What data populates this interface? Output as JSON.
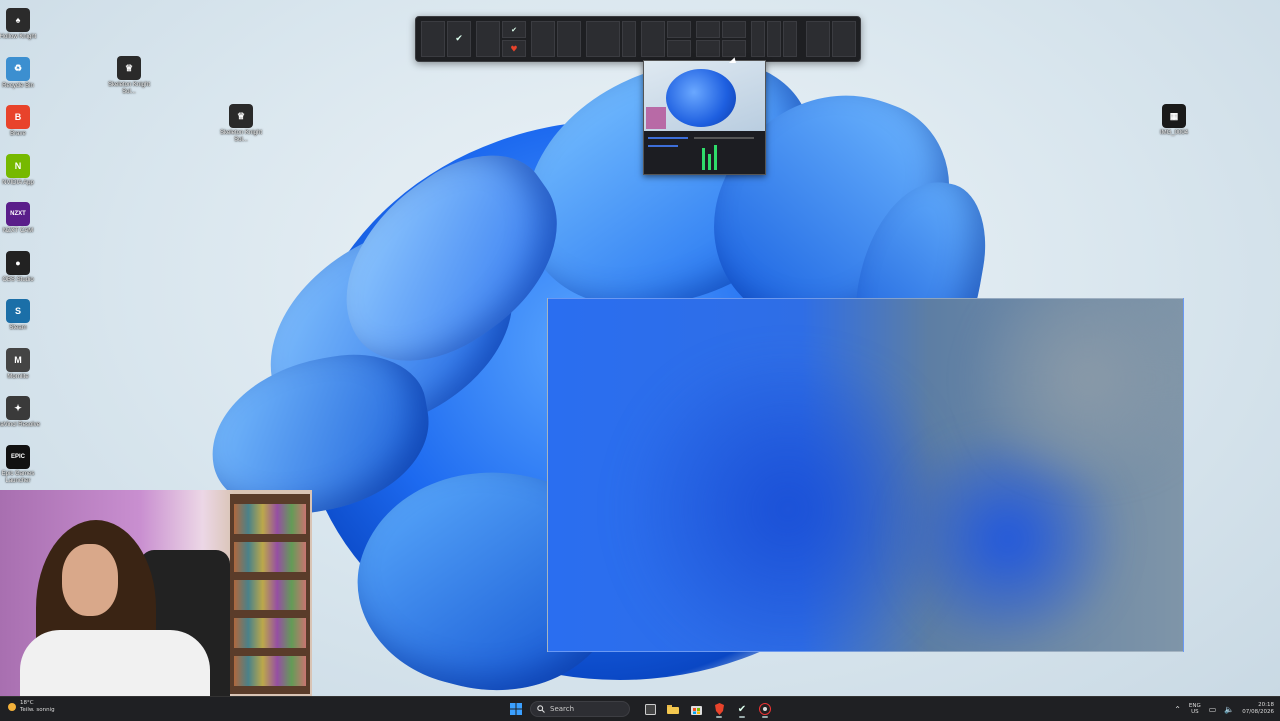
{
  "desktop": {
    "icons_left": [
      {
        "label": "Hollow Knight",
        "icon": "hollow-knight-icon",
        "color": "#2b2b2b",
        "glyph": "♠"
      },
      {
        "label": "Recycle Bin",
        "icon": "recycle-bin-icon",
        "color": "#3c8fd0",
        "glyph": "♻"
      },
      {
        "label": "Brave",
        "icon": "brave-icon",
        "color": "#e8432b",
        "glyph": "B"
      },
      {
        "label": "NVIDIA App",
        "icon": "nvidia-icon",
        "color": "#76b900",
        "glyph": "N"
      },
      {
        "label": "NZXT CAM",
        "icon": "nzxt-cam-icon",
        "color": "#5a1e8a",
        "glyph": "NZXT"
      },
      {
        "label": "OBS Studio",
        "icon": "obs-icon",
        "color": "#222222",
        "glyph": "●"
      },
      {
        "label": "Steam",
        "icon": "steam-icon",
        "color": "#1b6fa8",
        "glyph": "S"
      },
      {
        "label": "Mornlite",
        "icon": "mornlite-icon",
        "color": "#444444",
        "glyph": "M"
      },
      {
        "label": "DaVinci Resolve",
        "icon": "davinci-icon",
        "color": "#3a3a3a",
        "glyph": "✦"
      },
      {
        "label": "Epic Games Launcher",
        "icon": "epic-games-icon",
        "color": "#111111",
        "glyph": "EPIC"
      }
    ],
    "icons_other": [
      {
        "label": "Skeleton Knight Sol...",
        "icon": "skeleton-knight-icon"
      },
      {
        "label": "Skeleton Knight Sol...",
        "icon": "skeleton-knight-icon"
      },
      {
        "label": "IMG_0004",
        "icon": "image-file-icon"
      }
    ]
  },
  "virtual_desktops": {
    "active_index": 5
  },
  "taskbar": {
    "weather_temp": "18°C",
    "weather_desc": "Teilw. sonnig",
    "search_placeholder": "Search",
    "lang_line1": "ENG",
    "lang_line2": "US",
    "time": "20:18",
    "date": "07/08/2026"
  },
  "colors": {
    "accent": "#40b4ff",
    "taskbar_bg": "#1f2023"
  }
}
